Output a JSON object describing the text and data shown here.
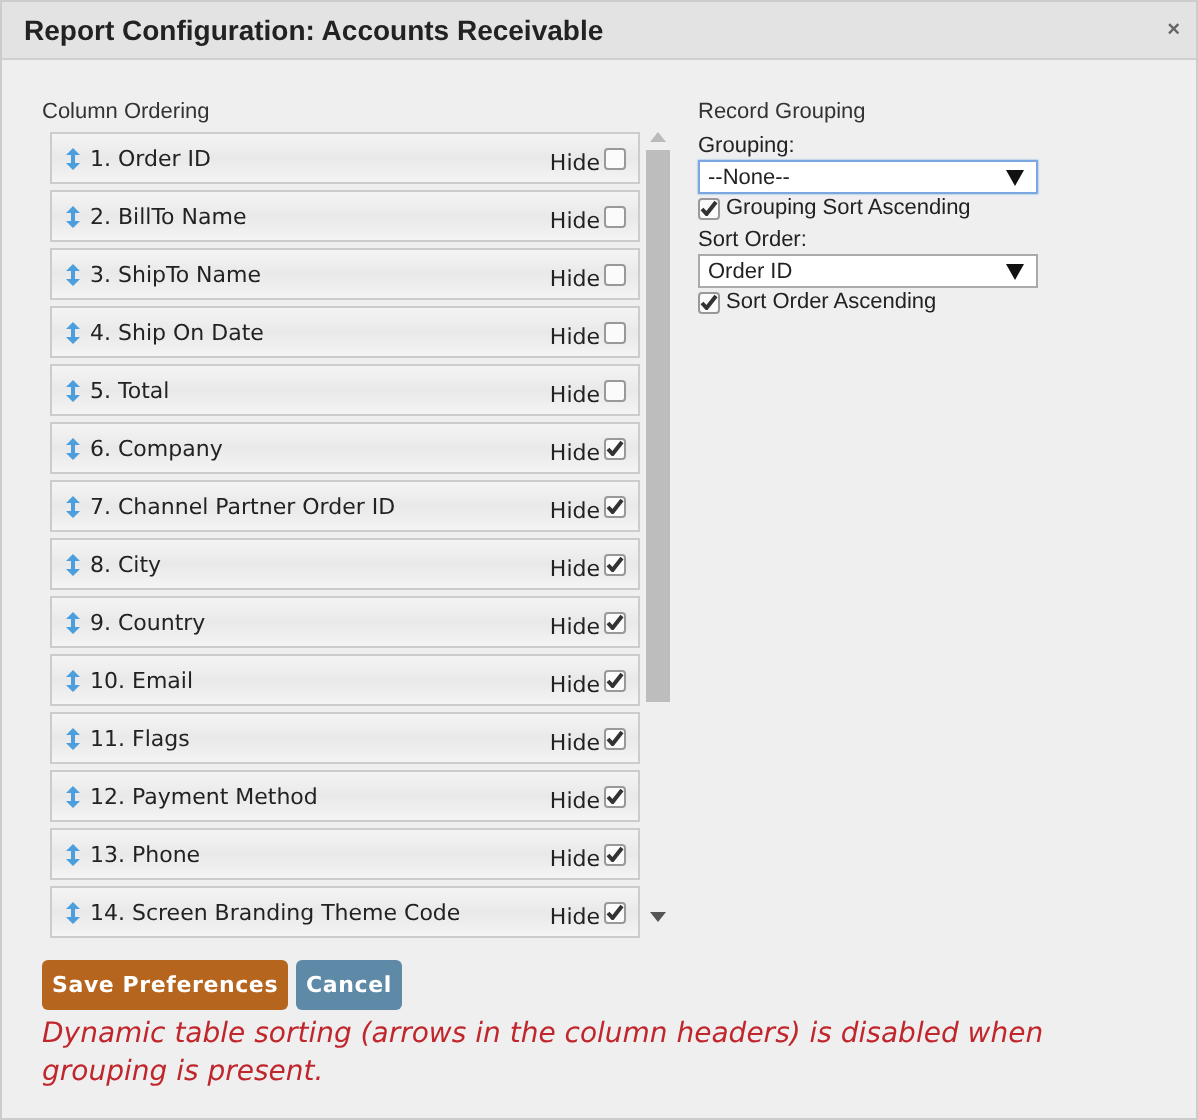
{
  "window": {
    "title": "Report Configuration: Accounts Receivable",
    "close": "×"
  },
  "column_ordering": {
    "title": "Column Ordering",
    "columns": [
      {
        "label": "1. Order ID",
        "hide_label": "Hide",
        "hidden": false
      },
      {
        "label": "2. BillTo Name",
        "hide_label": "Hide",
        "hidden": false
      },
      {
        "label": "3. ShipTo Name",
        "hide_label": "Hide",
        "hidden": false
      },
      {
        "label": "4. Ship On Date",
        "hide_label": "Hide",
        "hidden": false
      },
      {
        "label": "5. Total",
        "hide_label": "Hide",
        "hidden": false
      },
      {
        "label": "6. Company",
        "hide_label": "Hide",
        "hidden": true
      },
      {
        "label": "7. Channel Partner Order ID",
        "hide_label": "Hide",
        "hidden": true
      },
      {
        "label": "8. City",
        "hide_label": "Hide",
        "hidden": true
      },
      {
        "label": "9. Country",
        "hide_label": "Hide",
        "hidden": true
      },
      {
        "label": "10. Email",
        "hide_label": "Hide",
        "hidden": true
      },
      {
        "label": "11. Flags",
        "hide_label": "Hide",
        "hidden": true
      },
      {
        "label": "12. Payment Method",
        "hide_label": "Hide",
        "hidden": true
      },
      {
        "label": "13. Phone",
        "hide_label": "Hide",
        "hidden": true
      },
      {
        "label": "14. Screen Branding Theme Code",
        "hide_label": "Hide",
        "hidden": true
      }
    ]
  },
  "record_grouping": {
    "title": "Record Grouping",
    "grouping": {
      "label": "Grouping:",
      "value": "--None--",
      "focused": true
    },
    "grouping_ascending": {
      "label": "Grouping Sort Ascending",
      "checked": true
    },
    "sort_order": {
      "label": "Sort Order:",
      "value": "Order ID",
      "focused": false
    },
    "sort_ascending": {
      "label": "Sort Order Ascending",
      "checked": true
    }
  },
  "buttons": [
    {
      "label": "Save Preferences",
      "kind": "primary"
    },
    {
      "label": "Cancel",
      "kind": "secondary"
    }
  ],
  "message": "Dynamic table sorting (arrows in the column headers) is disabled when grouping is present."
}
